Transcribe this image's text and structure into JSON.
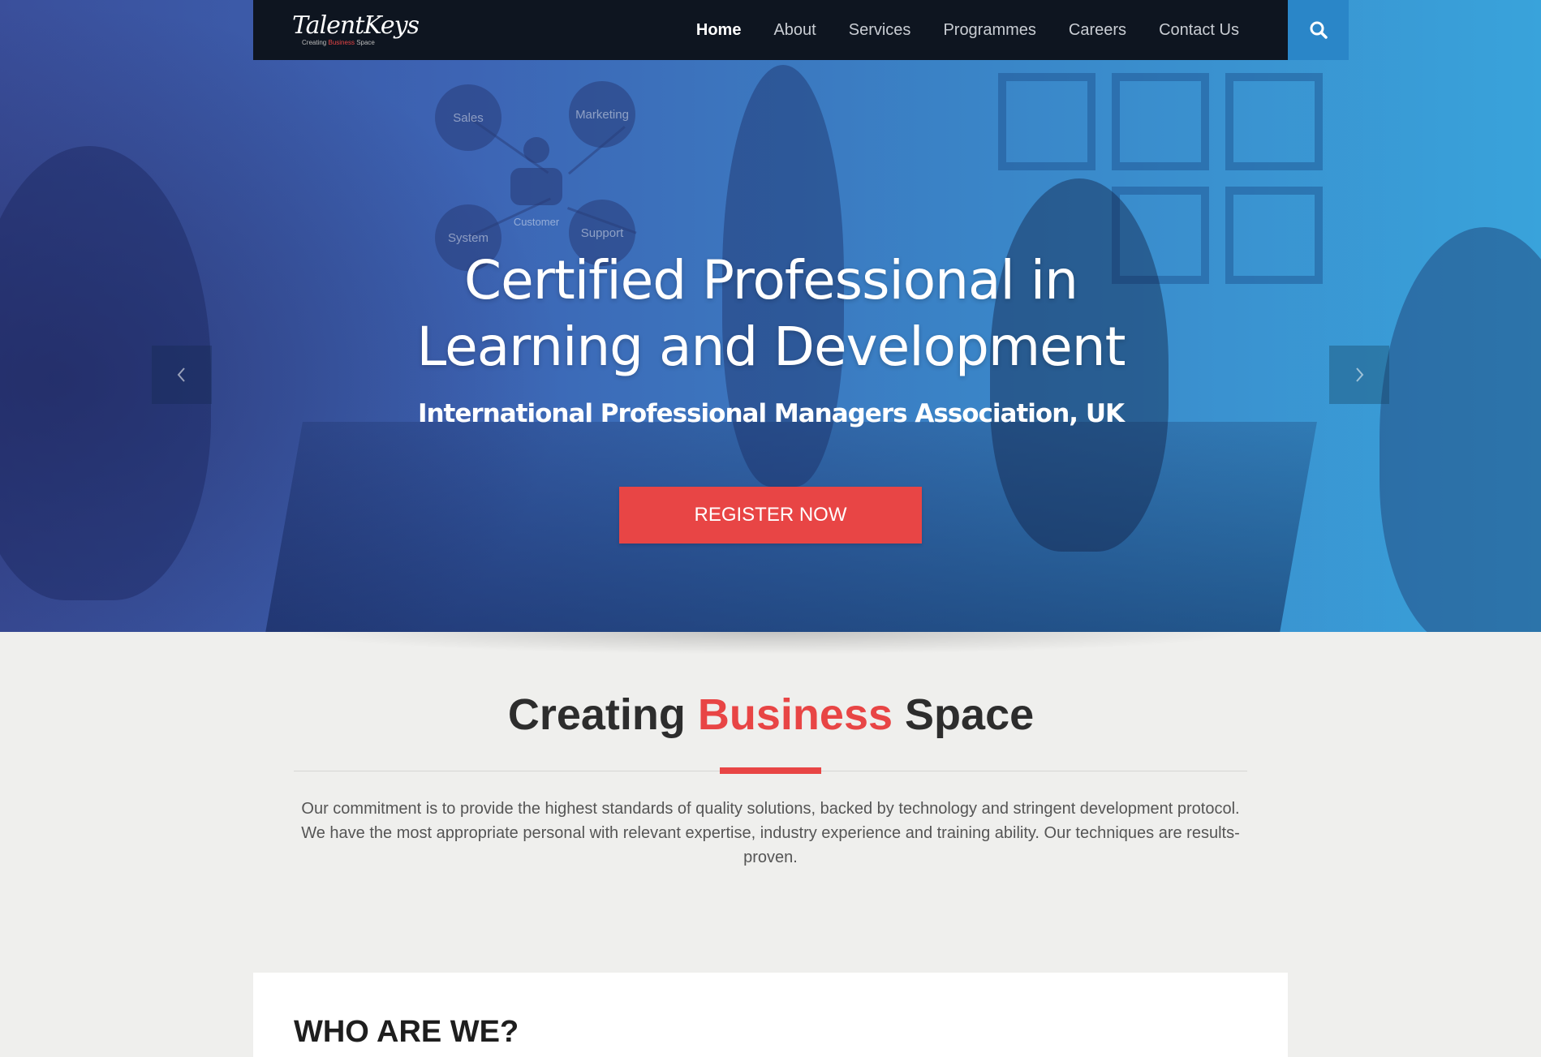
{
  "brand": {
    "name": "TalentKeys",
    "tagline_prefix": "Creating",
    "tagline_accent": "Business",
    "tagline_suffix": "Space"
  },
  "nav": {
    "items": [
      {
        "label": "Home",
        "active": true
      },
      {
        "label": "About",
        "active": false
      },
      {
        "label": "Services",
        "active": false
      },
      {
        "label": "Programmes",
        "active": false
      },
      {
        "label": "Careers",
        "active": false
      },
      {
        "label": "Contact Us",
        "active": false
      }
    ],
    "search_icon": "search-icon"
  },
  "hero": {
    "diagram_labels": [
      "Sales",
      "Marketing",
      "System",
      "Customer",
      "Support"
    ],
    "title_line1": "Certified Professional in",
    "title_line2": "Learning and Development",
    "subtitle": "International Professional Managers Association, UK",
    "cta_label": "REGISTER NOW",
    "prev_icon": "chevron-left-icon",
    "next_icon": "chevron-right-icon"
  },
  "intro": {
    "title_part1": "Creating",
    "title_accent": "Business",
    "title_part2": "Space",
    "text": "Our commitment is to provide the highest standards of quality solutions, backed by technology and stringent development protocol. We have the most appropriate personal with relevant expertise, industry experience and training ability. Our techniques are results-proven."
  },
  "who": {
    "title": "WHO ARE WE?"
  },
  "colors": {
    "accent": "#e84545",
    "nav_bg": "#0e1520",
    "search_bg": "#2a86c8",
    "page_bg": "#efefed"
  }
}
